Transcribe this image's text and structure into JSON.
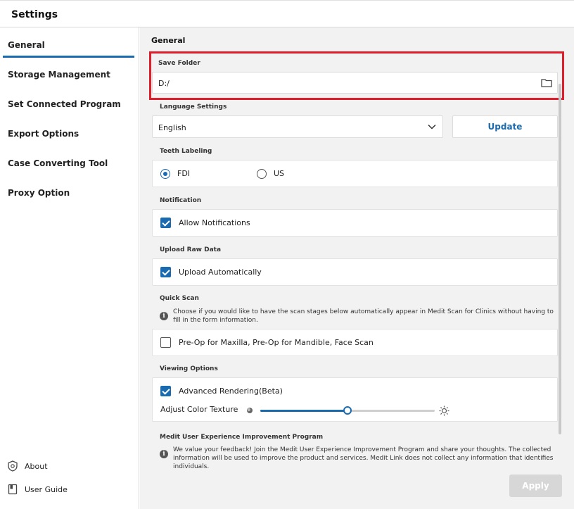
{
  "window": {
    "title": "Settings"
  },
  "sidebar": {
    "items": [
      {
        "label": "General",
        "active": true
      },
      {
        "label": "Storage Management",
        "active": false
      },
      {
        "label": "Set Connected Program",
        "active": false
      },
      {
        "label": "Export Options",
        "active": false
      },
      {
        "label": "Case Converting Tool",
        "active": false
      },
      {
        "label": "Proxy Option",
        "active": false
      }
    ],
    "footer": [
      {
        "label": "About",
        "icon": "shield-icon"
      },
      {
        "label": "User Guide",
        "icon": "book-icon"
      }
    ]
  },
  "main": {
    "section_title": "General",
    "save_folder": {
      "label": "Save Folder",
      "value": "D:/",
      "icon": "folder-icon"
    },
    "language": {
      "label": "Language Settings",
      "selected": "English",
      "update_label": "Update"
    },
    "teeth_labeling": {
      "label": "Teeth Labeling",
      "options": [
        {
          "label": "FDI",
          "selected": true
        },
        {
          "label": "US",
          "selected": false
        }
      ]
    },
    "notification": {
      "label": "Notification",
      "option": "Allow Notifications",
      "checked": true
    },
    "upload_raw": {
      "label": "Upload Raw Data",
      "option": "Upload Automatically",
      "checked": true
    },
    "quick_scan": {
      "label": "Quick Scan",
      "info": "Choose if you would like to have the scan stages below automatically appear in Medit Scan for Clinics without having to fill in the form information.",
      "option": "Pre-Op for Maxilla, Pre-Op for Mandible, Face Scan",
      "checked": false
    },
    "viewing": {
      "label": "Viewing Options",
      "option": "Advanced Rendering(Beta)",
      "checked": true,
      "slider_label": "Adjust Color Texture",
      "slider_value": 0.5
    },
    "improvement": {
      "label": "Medit User Experience Improvement Program",
      "info": "We value your feedback! Join the Medit User Experience Improvement Program and share your thoughts. The collected information will be used to improve the product and services. Medit Link does not collect any information that identifies individuals."
    },
    "apply_label": "Apply"
  },
  "colors": {
    "accent": "#1a6ab0",
    "highlight": "#e01e2b",
    "background": "#f2f2f2"
  }
}
